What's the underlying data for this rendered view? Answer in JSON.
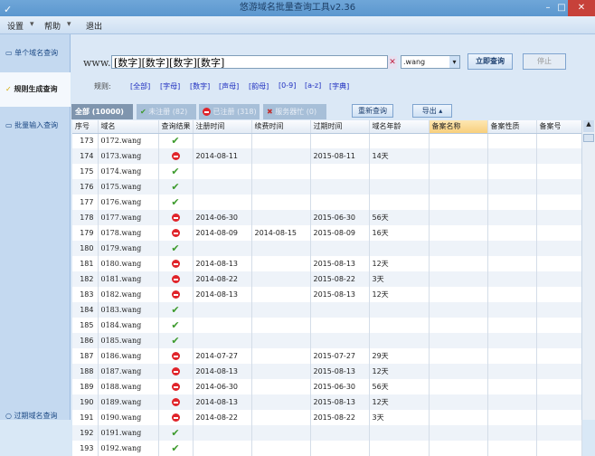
{
  "window": {
    "title": "悠游域名批量查询工具v2.36",
    "minimize": "–",
    "maximize": "□",
    "close": "✕"
  },
  "menu": {
    "settings": "设置",
    "help": "帮助",
    "exit": "退出",
    "dropdown": "▾"
  },
  "sidebar": {
    "items": [
      {
        "label": "单个域名查询",
        "icon": "window-icon"
      },
      {
        "label": "规则生成查询",
        "icon": "pen-icon"
      },
      {
        "label": "批量输入查询",
        "icon": "window-icon"
      }
    ],
    "expired": "过期域名查询"
  },
  "query": {
    "prefix": "www.",
    "domain_value": "[数字][数字][数字][数字]",
    "suffix": ".wang",
    "search": "立即查询",
    "stop": "停止"
  },
  "rules": {
    "label": "规则:",
    "items": [
      "[全部]",
      "[字母]",
      "[数字]",
      "[声母]",
      "[韵母]",
      "[0-9]",
      "[a-z]",
      "[字典]"
    ]
  },
  "filters": {
    "all": "全部 (10000)",
    "available": "未注册 (82)",
    "registered": "已注册 (318)",
    "busy": "服务器忙 (0)",
    "requery": "重新查询",
    "export": "导出 ▴"
  },
  "table": {
    "columns": [
      "序号",
      "域名",
      "查询结果",
      "注册时间",
      "续费时间",
      "过期时间",
      "域名年龄",
      "备案名称",
      "备案性质",
      "备案号"
    ],
    "rows": [
      [
        "173",
        "0172.wang",
        "ok",
        "",
        "",
        "",
        "",
        "",
        "",
        ""
      ],
      [
        "174",
        "0173.wang",
        "reg",
        "2014-08-11",
        "",
        "2015-08-11",
        "14天",
        "",
        "",
        ""
      ],
      [
        "175",
        "0174.wang",
        "ok",
        "",
        "",
        "",
        "",
        "",
        "",
        ""
      ],
      [
        "176",
        "0175.wang",
        "ok",
        "",
        "",
        "",
        "",
        "",
        "",
        ""
      ],
      [
        "177",
        "0176.wang",
        "ok",
        "",
        "",
        "",
        "",
        "",
        "",
        ""
      ],
      [
        "178",
        "0177.wang",
        "reg",
        "2014-06-30",
        "",
        "2015-06-30",
        "56天",
        "",
        "",
        ""
      ],
      [
        "179",
        "0178.wang",
        "reg",
        "2014-08-09",
        "2014-08-15",
        "2015-08-09",
        "16天",
        "",
        "",
        ""
      ],
      [
        "180",
        "0179.wang",
        "ok",
        "",
        "",
        "",
        "",
        "",
        "",
        ""
      ],
      [
        "181",
        "0180.wang",
        "reg",
        "2014-08-13",
        "",
        "2015-08-13",
        "12天",
        "",
        "",
        ""
      ],
      [
        "182",
        "0181.wang",
        "reg",
        "2014-08-22",
        "",
        "2015-08-22",
        "3天",
        "",
        "",
        ""
      ],
      [
        "183",
        "0182.wang",
        "reg",
        "2014-08-13",
        "",
        "2015-08-13",
        "12天",
        "",
        "",
        ""
      ],
      [
        "184",
        "0183.wang",
        "ok",
        "",
        "",
        "",
        "",
        "",
        "",
        ""
      ],
      [
        "185",
        "0184.wang",
        "ok",
        "",
        "",
        "",
        "",
        "",
        "",
        ""
      ],
      [
        "186",
        "0185.wang",
        "ok",
        "",
        "",
        "",
        "",
        "",
        "",
        ""
      ],
      [
        "187",
        "0186.wang",
        "reg",
        "2014-07-27",
        "",
        "2015-07-27",
        "29天",
        "",
        "",
        ""
      ],
      [
        "188",
        "0187.wang",
        "reg",
        "2014-08-13",
        "",
        "2015-08-13",
        "12天",
        "",
        "",
        ""
      ],
      [
        "189",
        "0188.wang",
        "reg",
        "2014-06-30",
        "",
        "2015-06-30",
        "56天",
        "",
        "",
        ""
      ],
      [
        "190",
        "0189.wang",
        "reg",
        "2014-08-13",
        "",
        "2015-08-13",
        "12天",
        "",
        "",
        ""
      ],
      [
        "191",
        "0190.wang",
        "reg",
        "2014-08-22",
        "",
        "2015-08-22",
        "3天",
        "",
        "",
        ""
      ],
      [
        "192",
        "0191.wang",
        "ok",
        "",
        "",
        "",
        "",
        "",
        "",
        ""
      ],
      [
        "193",
        "0192.wang",
        "ok",
        "",
        "",
        "",
        "",
        "",
        "",
        ""
      ]
    ]
  }
}
